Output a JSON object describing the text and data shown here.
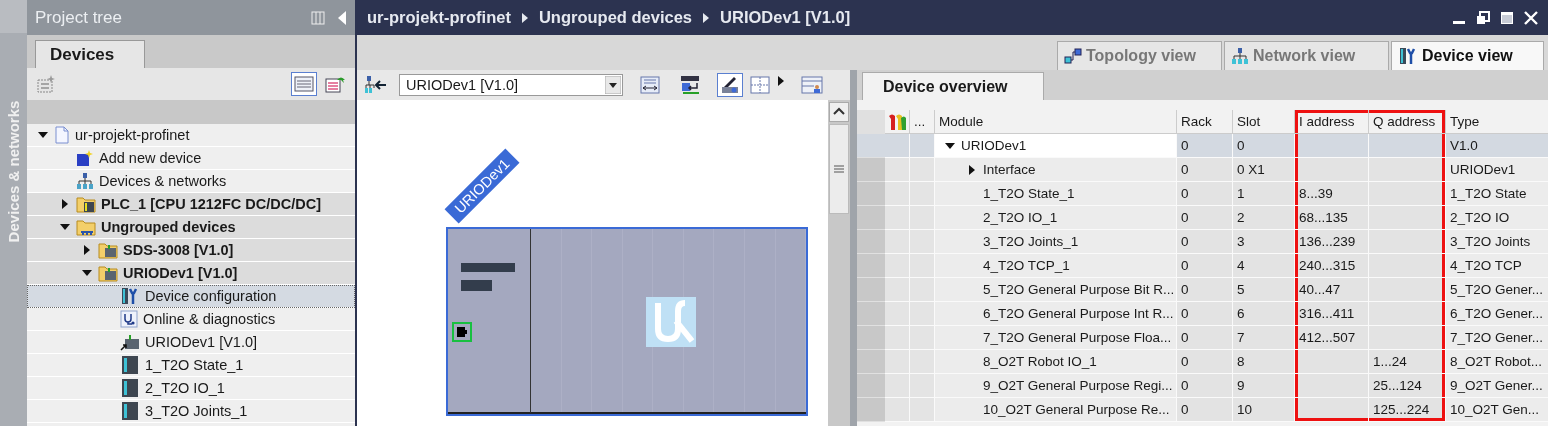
{
  "side_strip": {
    "label": "Devices & networks"
  },
  "project_tree": {
    "title": "Project tree",
    "tabs": [
      {
        "label": "Devices",
        "selected": true
      }
    ],
    "toolbar": [
      {
        "kind": "new-group",
        "on": false
      },
      {
        "kind": "details-view",
        "on": true
      },
      {
        "kind": "export",
        "on": false
      }
    ],
    "items": [
      {
        "label": "ur-projekt-profinet",
        "kind": "project",
        "expanded": true,
        "selected": false,
        "children": [
          {
            "label": "Add new device",
            "kind": "add",
            "selected": false
          },
          {
            "label": "Devices & networks",
            "kind": "network",
            "selected": false
          },
          {
            "label": "PLC_1 [CPU 1212FC DC/DC/DC]",
            "kind": "plc",
            "expanded": false,
            "selected": false
          },
          {
            "label": "Ungrouped devices",
            "kind": "group",
            "expanded": true,
            "selected": false,
            "children": [
              {
                "label": "SDS-3008 [V1.0]",
                "kind": "device",
                "expanded": false,
                "selected": false
              },
              {
                "label": "URIODev1 [V1.0]",
                "kind": "device",
                "expanded": true,
                "selected": false,
                "children": [
                  {
                    "label": "Device configuration",
                    "kind": "config",
                    "selected": true
                  },
                  {
                    "label": "Online & diagnostics",
                    "kind": "diagnostics",
                    "selected": false
                  },
                  {
                    "label": "URIODev1 [V1.0]",
                    "kind": "proxy",
                    "selected": false
                  },
                  {
                    "label": "1_T2O State_1",
                    "kind": "module",
                    "selected": false
                  },
                  {
                    "label": "2_T2O IO_1",
                    "kind": "module",
                    "selected": false
                  },
                  {
                    "label": "3_T2O Joints_1",
                    "kind": "module",
                    "selected": false
                  }
                ]
              }
            ]
          }
        ]
      }
    ]
  },
  "editor": {
    "breadcrumb": [
      "ur-projekt-profinet",
      "Ungrouped devices",
      "URIODev1 [V1.0]"
    ],
    "view_tabs": [
      {
        "label": "Topology view",
        "kind": "topology",
        "selected": false
      },
      {
        "label": "Network view",
        "kind": "network",
        "selected": false
      },
      {
        "label": "Device view",
        "kind": "device",
        "selected": true
      }
    ],
    "toolbar": [
      {
        "kind": "topology-link",
        "on": false
      },
      {
        "kind": "selector",
        "value": "URIODev1 [V1.0]"
      },
      {
        "kind": "fit",
        "on": false
      },
      {
        "kind": "name",
        "on": false
      },
      {
        "kind": "pencil",
        "on": true
      },
      {
        "kind": "grid",
        "on": false
      },
      {
        "kind": "more"
      },
      {
        "kind": "panel",
        "on": false
      }
    ],
    "canvas": {
      "device_label": "URIODev1"
    }
  },
  "device_overview": {
    "tab": "Device overview",
    "columns": [
      {
        "kind": "icon",
        "highlighted": false
      },
      {
        "kind": "text",
        "label": "...",
        "highlighted": false
      },
      {
        "kind": "text",
        "label": "Module",
        "highlighted": false
      },
      {
        "kind": "text",
        "label": "Rack",
        "highlighted": false
      },
      {
        "kind": "text",
        "label": "Slot",
        "highlighted": false
      },
      {
        "kind": "text",
        "label": "I address",
        "highlighted": true
      },
      {
        "kind": "text",
        "label": "Q address",
        "highlighted": true
      },
      {
        "kind": "text",
        "label": "Type",
        "highlighted": false
      }
    ],
    "rows": [
      {
        "module": "URIODev1",
        "rack": "0",
        "slot": "0",
        "type": "V1.0",
        "expanded": true,
        "selected": true,
        "children": [
          {
            "module": "Interface",
            "rack": "0",
            "slot": "0 X1",
            "type": "URIODev1",
            "expanded": false,
            "selected": false
          },
          {
            "module": "1_T2O State_1",
            "rack": "0",
            "slot": "1",
            "i_address": "8...39",
            "type": "1_T2O State",
            "selected": false
          },
          {
            "module": "2_T2O IO_1",
            "rack": "0",
            "slot": "2",
            "i_address": "68...135",
            "type": "2_T2O IO",
            "selected": false
          },
          {
            "module": "3_T2O Joints_1",
            "rack": "0",
            "slot": "3",
            "i_address": "136...239",
            "type": "3_T2O Joints",
            "selected": false
          },
          {
            "module": "4_T2O TCP_1",
            "rack": "0",
            "slot": "4",
            "i_address": "240...315",
            "type": "4_T2O TCP",
            "selected": false
          },
          {
            "module": "5_T2O General Purpose Bit R...",
            "rack": "0",
            "slot": "5",
            "i_address": "40...47",
            "type": "5_T2O Gener...",
            "selected": false
          },
          {
            "module": "6_T2O General Purpose Int R...",
            "rack": "0",
            "slot": "6",
            "i_address": "316...411",
            "type": "6_T2O Gener...",
            "selected": false
          },
          {
            "module": "7_T2O General Purpose Floa...",
            "rack": "0",
            "slot": "7",
            "i_address": "412...507",
            "type": "7_T2O Gener...",
            "selected": false
          },
          {
            "module": "8_O2T Robot IO_1",
            "rack": "0",
            "slot": "8",
            "q_address": "1...24",
            "type": "8_O2T Robot...",
            "selected": false
          },
          {
            "module": "9_O2T General Purpose Regi...",
            "rack": "0",
            "slot": "9",
            "q_address": "25...124",
            "type": "9_O2T Gener...",
            "selected": false
          },
          {
            "module": "10_O2T General Purpose Re...",
            "rack": "0",
            "slot": "10",
            "q_address": "125...224",
            "type": "10_O2T Gen...",
            "selected": false
          }
        ]
      }
    ]
  }
}
